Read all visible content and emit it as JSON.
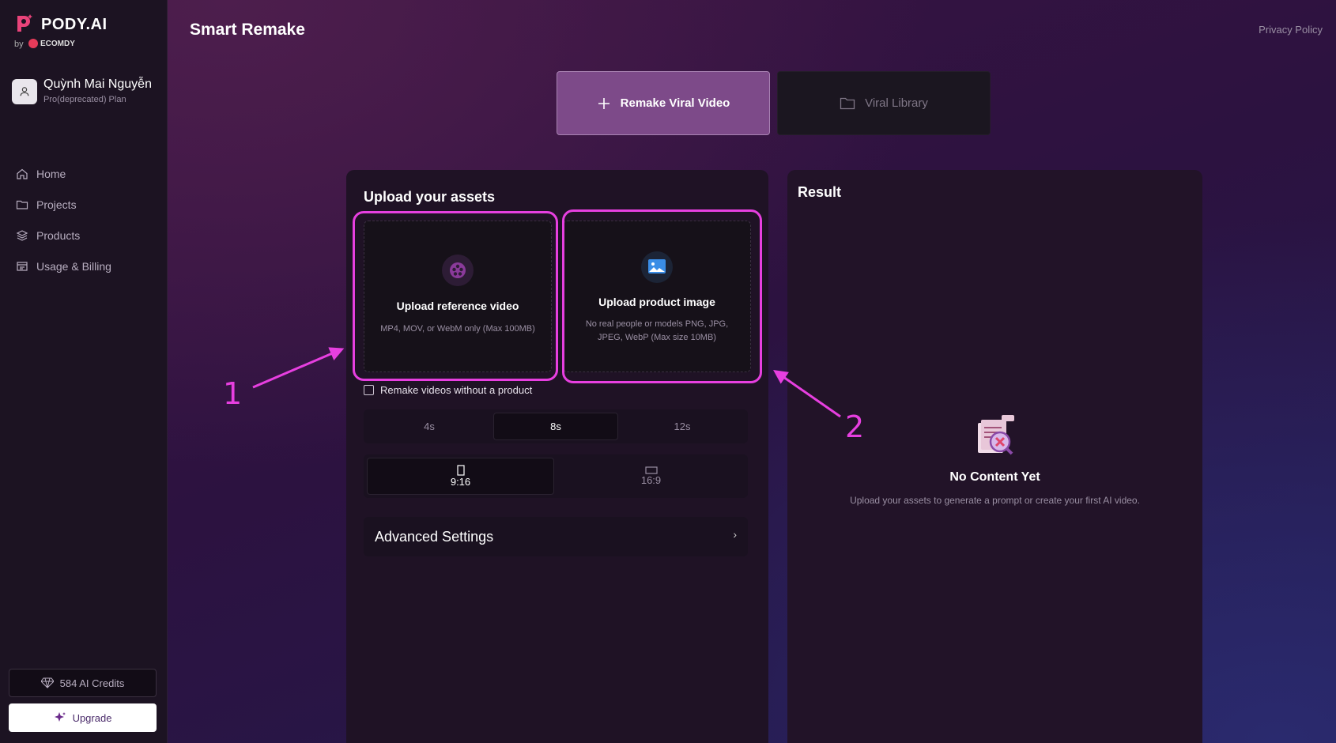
{
  "brand": {
    "name": "PODY.AI",
    "by": "by",
    "partner": "ECOMDY"
  },
  "user": {
    "name": "Quỳnh Mai Nguyễn",
    "plan": "Pro(deprecated) Plan"
  },
  "nav": [
    {
      "label": "Home",
      "icon": "home-icon"
    },
    {
      "label": "Projects",
      "icon": "folder-icon"
    },
    {
      "label": "Products",
      "icon": "layers-icon"
    },
    {
      "label": "Usage & Billing",
      "icon": "billing-icon"
    }
  ],
  "credits": "584 AI Credits",
  "upgrade": "Upgrade",
  "header": {
    "title": "Smart Remake",
    "privacy": "Privacy Policy"
  },
  "modes": {
    "remake": "Remake Viral Video",
    "library": "Viral Library"
  },
  "upload": {
    "title": "Upload your assets",
    "video": {
      "title": "Upload reference video",
      "sub": "MP4, MOV, or WebM only (Max 100MB)"
    },
    "image": {
      "title": "Upload product image",
      "sub": "No real people or models PNG, JPG, JPEG, WebP (Max size 10MB)"
    },
    "checkbox_label": "Remake videos without a product",
    "checkbox_checked": false
  },
  "durations": {
    "options": [
      "4s",
      "8s",
      "12s"
    ],
    "selected": "8s"
  },
  "ratios": {
    "options": [
      "9:16",
      "16:9"
    ],
    "selected": "9:16"
  },
  "advanced": "Advanced Settings",
  "result": {
    "title": "Result",
    "empty_title": "No Content Yet",
    "empty_sub": "Upload your assets to generate a prompt or create your first AI video."
  },
  "annotations": {
    "one": "1",
    "two": "2",
    "color": "#e73fe0"
  },
  "colors": {
    "accent": "#7d4a89",
    "annotation": "#e73fe0"
  }
}
